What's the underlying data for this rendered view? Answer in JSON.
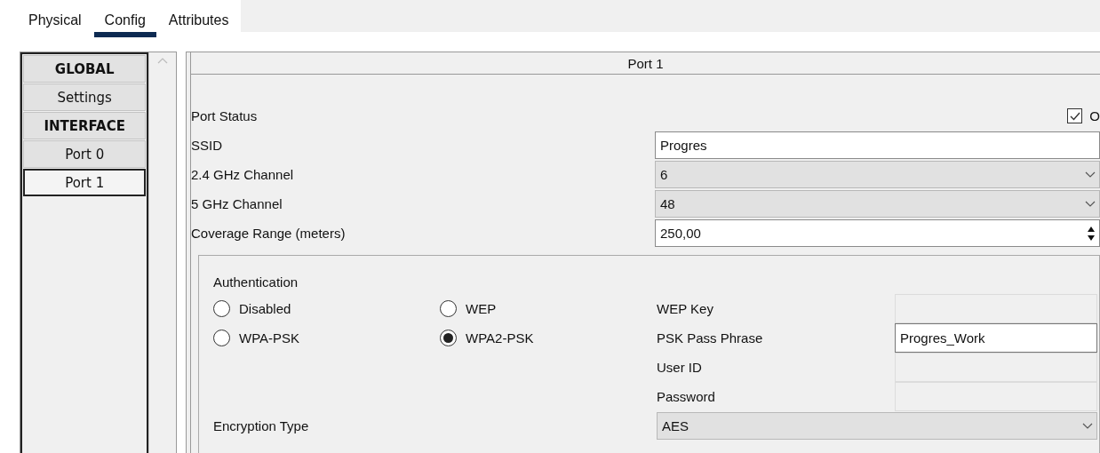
{
  "tabs": [
    {
      "label": "Physical",
      "selected": false
    },
    {
      "label": "Config",
      "selected": true
    },
    {
      "label": "Attributes",
      "selected": false
    }
  ],
  "sidebar": {
    "items": [
      {
        "label": "GLOBAL",
        "kind": "header",
        "selected": false
      },
      {
        "label": "Settings",
        "kind": "item",
        "selected": false
      },
      {
        "label": "INTERFACE",
        "kind": "header",
        "selected": false
      },
      {
        "label": "Port 0",
        "kind": "item",
        "selected": false
      },
      {
        "label": "Port 1",
        "kind": "item",
        "selected": true
      }
    ]
  },
  "panel": {
    "title": "Port 1",
    "port_status": {
      "label": "Port Status",
      "checked": true,
      "checkbox_label": "O"
    },
    "fields": [
      {
        "label": "SSID",
        "kind": "text",
        "value": "Progres"
      },
      {
        "label": "2.4 GHz Channel",
        "kind": "select",
        "value": "6"
      },
      {
        "label": "5 GHz Channel",
        "kind": "select",
        "value": "48"
      },
      {
        "label": "Coverage Range (meters)",
        "kind": "spin",
        "value": "250,00"
      }
    ],
    "authentication": {
      "title": "Authentication",
      "options": [
        {
          "label": "Disabled",
          "selected": false
        },
        {
          "label": "WEP",
          "selected": false
        },
        {
          "label": "WPA-PSK",
          "selected": false
        },
        {
          "label": "WPA2-PSK",
          "selected": true
        }
      ],
      "fields": [
        {
          "label": "WEP Key",
          "disabled": true
        },
        {
          "label": "PSK Pass Phrase",
          "value": "Progres_Work",
          "disabled": false
        },
        {
          "label": "User ID",
          "disabled": true
        },
        {
          "label": "Password",
          "disabled": true
        }
      ],
      "encryption": {
        "label": "Encryption Type",
        "value": "AES"
      }
    }
  }
}
